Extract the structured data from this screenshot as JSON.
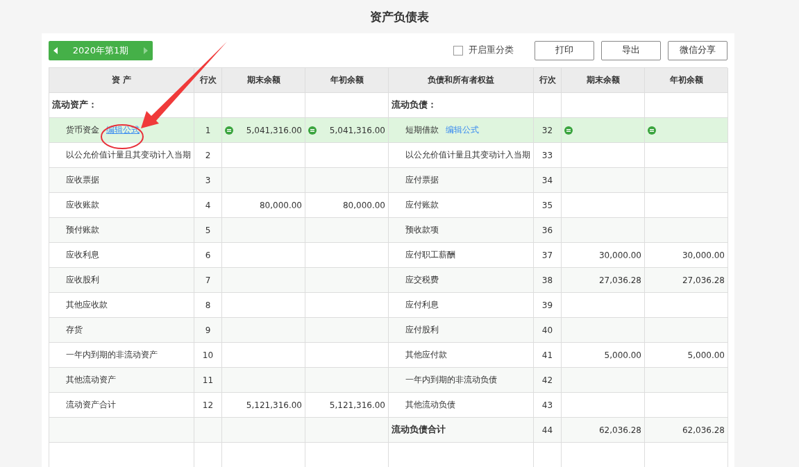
{
  "title": "资产负债表",
  "period": {
    "label": "2020年第1期",
    "prev_enabled": true,
    "next_enabled": false
  },
  "reclassify": {
    "label": "开启重分类",
    "checked": false
  },
  "buttons": [
    "打印",
    "导出",
    "微信分享"
  ],
  "columns": [
    "资 产",
    "行次",
    "期末余额",
    "年初余额",
    "负债和所有者权益",
    "行次",
    "期末余额",
    "年初余额"
  ],
  "rows": [
    {
      "selected": false,
      "left": {
        "kind": "section",
        "label": "流动资产："
      },
      "right": {
        "kind": "section",
        "label": "流动负债："
      }
    },
    {
      "selected": true,
      "left": {
        "kind": "item",
        "label": "货币资金",
        "link": {
          "text": "编辑公式",
          "underlined": true
        },
        "formula": true,
        "line": "1",
        "end": "5,041,316.00",
        "begin": "5,041,316.00"
      },
      "right": {
        "kind": "item",
        "label": "短期借款",
        "link": {
          "text": "编辑公式",
          "underlined": false
        },
        "formula": true,
        "line": "32"
      }
    },
    {
      "selected": false,
      "left": {
        "kind": "item",
        "label": "以公允价值计量且其变动计入当期",
        "line": "2"
      },
      "right": {
        "kind": "item",
        "label": "以公允价值计量且其变动计入当期",
        "line": "33"
      }
    },
    {
      "selected": false,
      "left": {
        "kind": "item",
        "label": "应收票据",
        "line": "3"
      },
      "right": {
        "kind": "item",
        "label": "应付票据",
        "line": "34"
      }
    },
    {
      "selected": false,
      "left": {
        "kind": "item",
        "label": "应收账款",
        "line": "4",
        "end": "80,000.00",
        "begin": "80,000.00"
      },
      "right": {
        "kind": "item",
        "label": "应付账款",
        "line": "35"
      }
    },
    {
      "selected": false,
      "left": {
        "kind": "item",
        "label": "预付账款",
        "line": "5"
      },
      "right": {
        "kind": "item",
        "label": "预收款项",
        "line": "36"
      }
    },
    {
      "selected": false,
      "left": {
        "kind": "item",
        "label": "应收利息",
        "line": "6"
      },
      "right": {
        "kind": "item",
        "label": "应付职工薪酬",
        "line": "37",
        "end": "30,000.00",
        "begin": "30,000.00"
      }
    },
    {
      "selected": false,
      "left": {
        "kind": "item",
        "label": "应收股利",
        "line": "7"
      },
      "right": {
        "kind": "item",
        "label": "应交税费",
        "line": "38",
        "end": "27,036.28",
        "begin": "27,036.28"
      }
    },
    {
      "selected": false,
      "left": {
        "kind": "item",
        "label": "其他应收款",
        "line": "8"
      },
      "right": {
        "kind": "item",
        "label": "应付利息",
        "line": "39"
      }
    },
    {
      "selected": false,
      "left": {
        "kind": "item",
        "label": "存货",
        "line": "9"
      },
      "right": {
        "kind": "item",
        "label": "应付股利",
        "line": "40"
      }
    },
    {
      "selected": false,
      "left": {
        "kind": "item",
        "label": "一年内到期的非流动资产",
        "line": "10"
      },
      "right": {
        "kind": "item",
        "label": "其他应付款",
        "line": "41",
        "end": "5,000.00",
        "begin": "5,000.00"
      }
    },
    {
      "selected": false,
      "left": {
        "kind": "item",
        "label": "其他流动资产",
        "line": "11"
      },
      "right": {
        "kind": "item",
        "label": "一年内到期的非流动负债",
        "line": "42"
      }
    },
    {
      "selected": false,
      "left": {
        "kind": "item",
        "label": "流动资产合计",
        "line": "12",
        "end": "5,121,316.00",
        "begin": "5,121,316.00"
      },
      "right": {
        "kind": "item",
        "label": "其他流动负债",
        "line": "43"
      }
    },
    {
      "selected": false,
      "left": {
        "kind": "blank"
      },
      "right": {
        "kind": "total",
        "label": "流动负债合计",
        "line": "44",
        "end": "62,036.28",
        "begin": "62,036.28"
      }
    },
    {
      "selected": false,
      "left": {
        "kind": "blank"
      },
      "right": {
        "kind": "blank"
      }
    }
  ]
}
